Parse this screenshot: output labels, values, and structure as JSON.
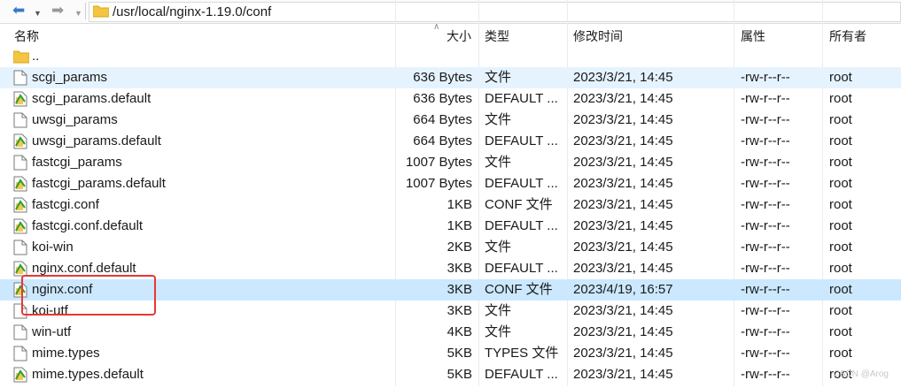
{
  "toolbar": {
    "path": "/usr/local/nginx-1.19.0/conf"
  },
  "columns": {
    "name": "名称",
    "size": "大小",
    "type": "类型",
    "modified": "修改时间",
    "perms": "属性",
    "owner": "所有者"
  },
  "parent": {
    "name": ".."
  },
  "files": [
    {
      "name": "scgi_params",
      "size": "636 Bytes",
      "type": "文件",
      "modified": "2023/3/21, 14:45",
      "perms": "-rw-r--r--",
      "owner": "root",
      "icon": "blank-file-icon"
    },
    {
      "name": "scgi_params.default",
      "size": "636 Bytes",
      "type": "DEFAULT ...",
      "modified": "2023/3/21, 14:45",
      "perms": "-rw-r--r--",
      "owner": "root",
      "icon": "default-file-icon"
    },
    {
      "name": "uwsgi_params",
      "size": "664 Bytes",
      "type": "文件",
      "modified": "2023/3/21, 14:45",
      "perms": "-rw-r--r--",
      "owner": "root",
      "icon": "blank-file-icon"
    },
    {
      "name": "uwsgi_params.default",
      "size": "664 Bytes",
      "type": "DEFAULT ...",
      "modified": "2023/3/21, 14:45",
      "perms": "-rw-r--r--",
      "owner": "root",
      "icon": "default-file-icon"
    },
    {
      "name": "fastcgi_params",
      "size": "1007 Bytes",
      "type": "文件",
      "modified": "2023/3/21, 14:45",
      "perms": "-rw-r--r--",
      "owner": "root",
      "icon": "blank-file-icon"
    },
    {
      "name": "fastcgi_params.default",
      "size": "1007 Bytes",
      "type": "DEFAULT ...",
      "modified": "2023/3/21, 14:45",
      "perms": "-rw-r--r--",
      "owner": "root",
      "icon": "default-file-icon"
    },
    {
      "name": "fastcgi.conf",
      "size": "1KB",
      "type": "CONF 文件",
      "modified": "2023/3/21, 14:45",
      "perms": "-rw-r--r--",
      "owner": "root",
      "icon": "default-file-icon"
    },
    {
      "name": "fastcgi.conf.default",
      "size": "1KB",
      "type": "DEFAULT ...",
      "modified": "2023/3/21, 14:45",
      "perms": "-rw-r--r--",
      "owner": "root",
      "icon": "default-file-icon"
    },
    {
      "name": "koi-win",
      "size": "2KB",
      "type": "文件",
      "modified": "2023/3/21, 14:45",
      "perms": "-rw-r--r--",
      "owner": "root",
      "icon": "blank-file-icon"
    },
    {
      "name": "nginx.conf.default",
      "size": "3KB",
      "type": "DEFAULT ...",
      "modified": "2023/3/21, 14:45",
      "perms": "-rw-r--r--",
      "owner": "root",
      "icon": "default-file-icon"
    },
    {
      "name": "nginx.conf",
      "size": "3KB",
      "type": "CONF 文件",
      "modified": "2023/4/19, 16:57",
      "perms": "-rw-r--r--",
      "owner": "root",
      "icon": "default-file-icon"
    },
    {
      "name": "koi-utf",
      "size": "3KB",
      "type": "文件",
      "modified": "2023/3/21, 14:45",
      "perms": "-rw-r--r--",
      "owner": "root",
      "icon": "blank-file-icon"
    },
    {
      "name": "win-utf",
      "size": "4KB",
      "type": "文件",
      "modified": "2023/3/21, 14:45",
      "perms": "-rw-r--r--",
      "owner": "root",
      "icon": "blank-file-icon"
    },
    {
      "name": "mime.types",
      "size": "5KB",
      "type": "TYPES 文件",
      "modified": "2023/3/21, 14:45",
      "perms": "-rw-r--r--",
      "owner": "root",
      "icon": "blank-file-icon"
    },
    {
      "name": "mime.types.default",
      "size": "5KB",
      "type": "DEFAULT ...",
      "modified": "2023/3/21, 14:45",
      "perms": "-rw-r--r--",
      "owner": "root",
      "icon": "default-file-icon"
    }
  ],
  "watermark": "CSDN @Arog"
}
